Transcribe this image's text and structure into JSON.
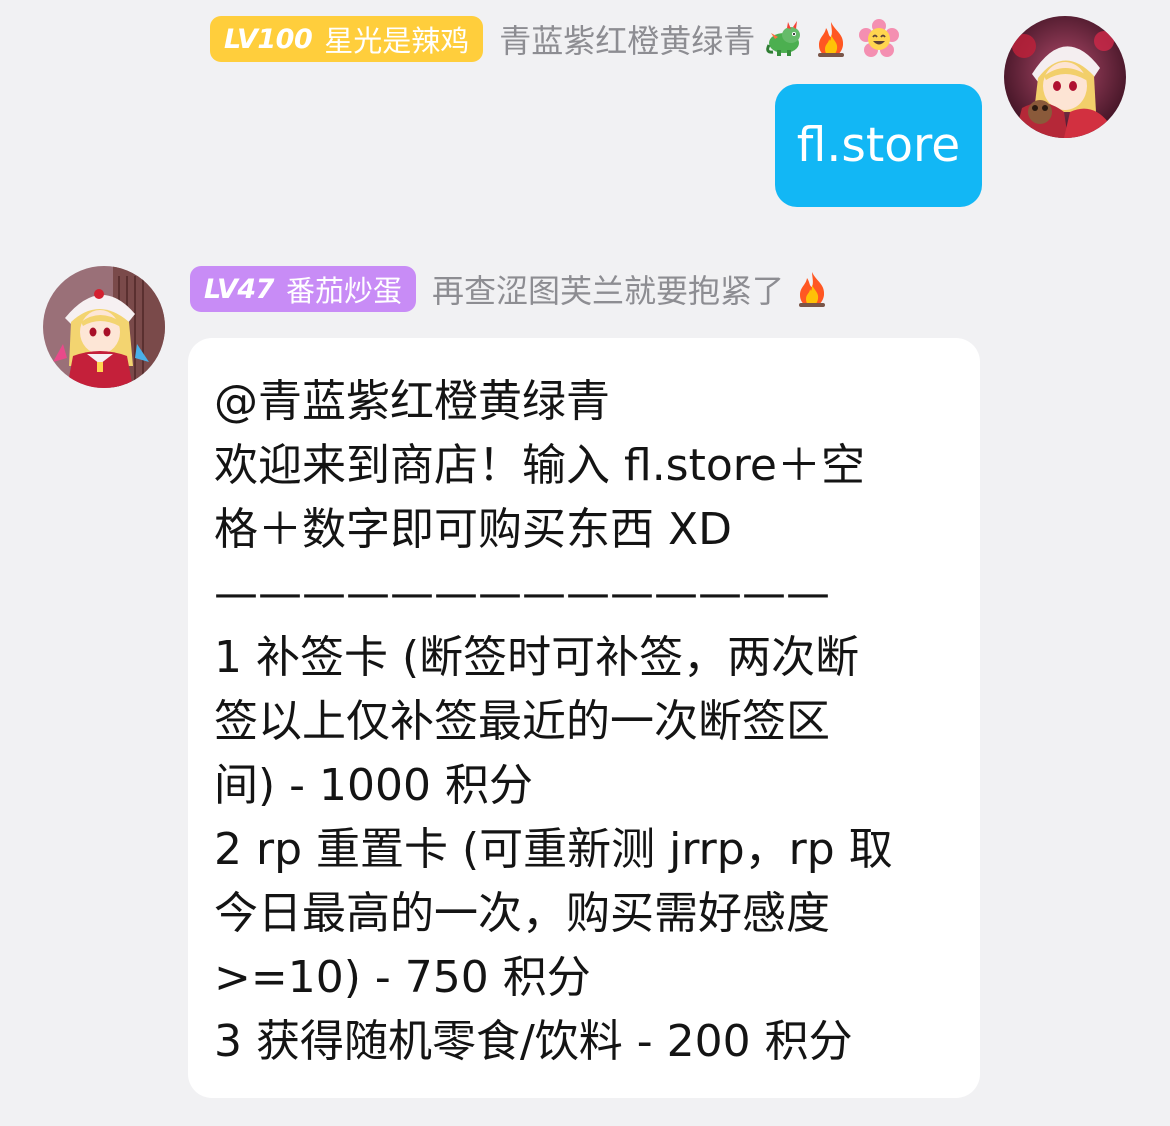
{
  "colors": {
    "background": "#f1f1f3",
    "self_bubble": "#12b7f5",
    "bot_bubble": "#ffffff",
    "badge_gold": "#ffce3c",
    "badge_purple": "#c88cf6",
    "title_gray": "#8d8d92"
  },
  "self_message": {
    "level_label": "LV100",
    "nickname": "星光是辣鸡",
    "title": "青蓝紫红橙黄绿青",
    "emojis": [
      "dragon-icon",
      "fire-icon",
      "smiling-flower-icon"
    ],
    "avatar": "avatar-anime-girl-icon",
    "text": "fl.store"
  },
  "bot_message": {
    "level_label": "LV47",
    "nickname": "番茄炒蛋",
    "title": "再查涩图芙兰就要抱紧了",
    "emojis": [
      "fire-icon"
    ],
    "avatar": "avatar-anime-girl-icon",
    "lines": [
      "@青蓝紫红橙黄绿青",
      "欢迎来到商店！输入 fl.store＋空",
      "格＋数字即可购买东西 XD",
      "——————————————",
      "1 补签卡 (断签时可补签，两次断",
      "签以上仅补签最近的一次断签区",
      "间) - 1000 积分",
      "2 rp 重置卡 (可重新测 jrrp，rp 取",
      "今日最高的一次，购买需好感度",
      ">=10) - 750 积分",
      "3 获得随机零食/饮料 - 200 积分"
    ]
  }
}
